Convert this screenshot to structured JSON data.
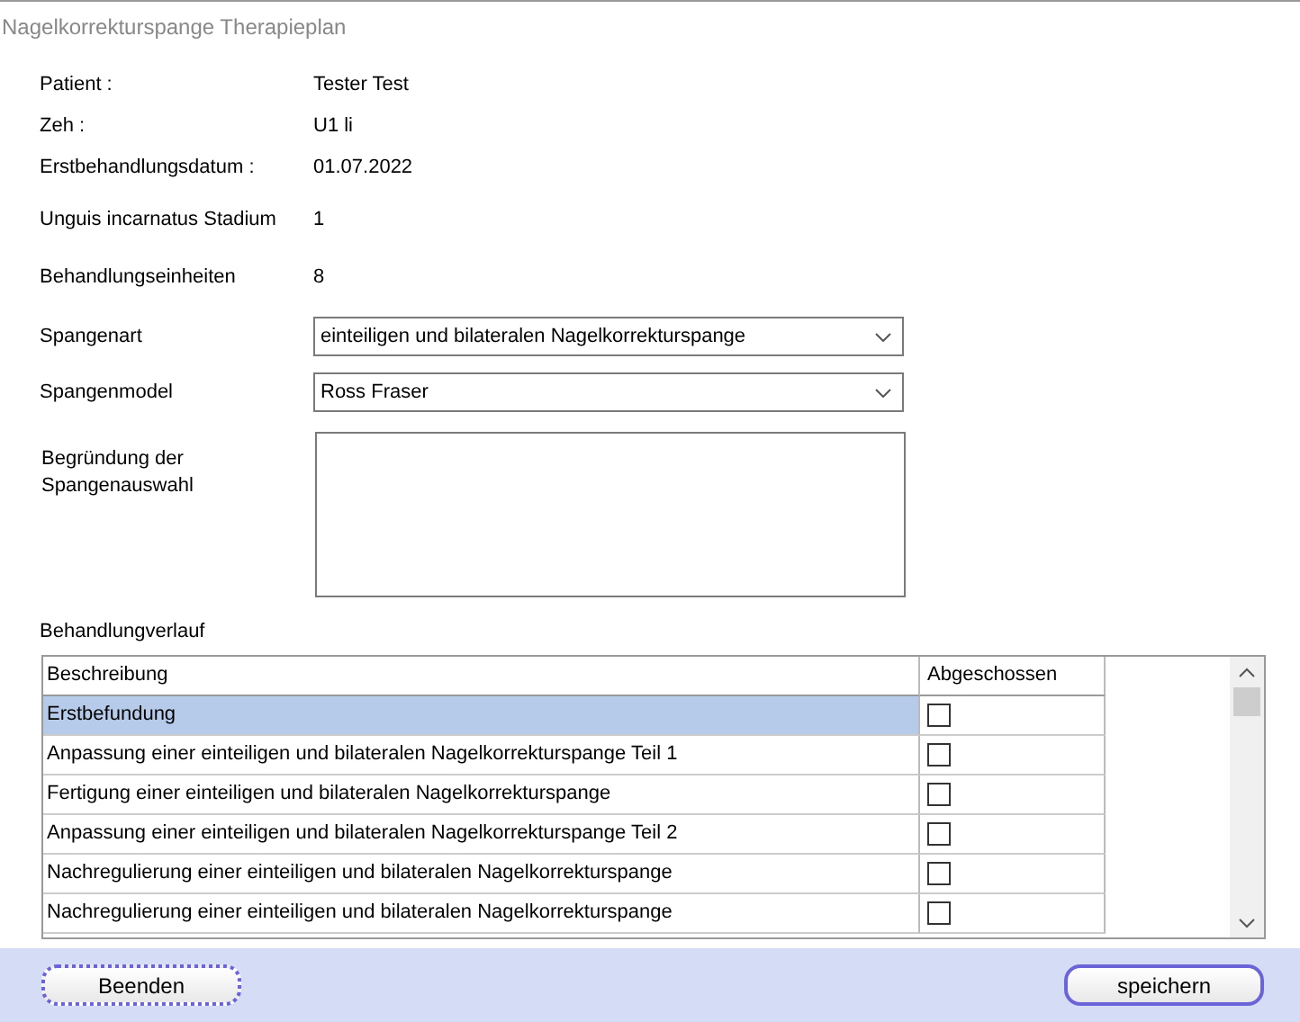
{
  "window": {
    "title": "Nagelkorrekturspange Therapieplan"
  },
  "info": [
    {
      "label": "Patient :",
      "value": "Tester  Test"
    },
    {
      "label": "Zeh :",
      "value": "U1 li"
    },
    {
      "label": "Erstbehandlungsdatum :",
      "value": "01.07.2022"
    },
    {
      "label": "Unguis incarnatus Stadium",
      "value": "1"
    },
    {
      "label": "Behandlungseinheiten",
      "value": "8"
    }
  ],
  "selects": [
    {
      "label": "Spangenart",
      "value": "einteiligen und bilateralen Nagelkorrekturspange"
    },
    {
      "label": "Spangenmodel",
      "value": "Ross Fraser"
    }
  ],
  "reason": {
    "label": "Begründung der Spangenauswahl"
  },
  "table": {
    "caption": "Behandlungverlauf",
    "columns": [
      "Beschreibung",
      "Abgeschossen"
    ],
    "rows": [
      {
        "text": "Erstbefundung",
        "checked": false,
        "selected": true
      },
      {
        "text": "Anpassung einer einteiligen und bilateralen Nagelkorrekturspange Teil 1",
        "checked": false,
        "selected": false
      },
      {
        "text": "Fertigung einer einteiligen und bilateralen Nagelkorrekturspange",
        "checked": false,
        "selected": false
      },
      {
        "text": "Anpassung einer einteiligen und bilateralen Nagelkorrekturspange Teil 2",
        "checked": false,
        "selected": false
      },
      {
        "text": "Nachregulierung einer einteiligen und bilateralen Nagelkorrekturspange",
        "checked": false,
        "selected": false
      },
      {
        "text": "Nachregulierung einer einteiligen und bilateralen Nagelkorrekturspange",
        "checked": false,
        "selected": false
      }
    ]
  },
  "buttons": [
    {
      "label": "Beenden"
    },
    {
      "label": "speichern"
    }
  ]
}
